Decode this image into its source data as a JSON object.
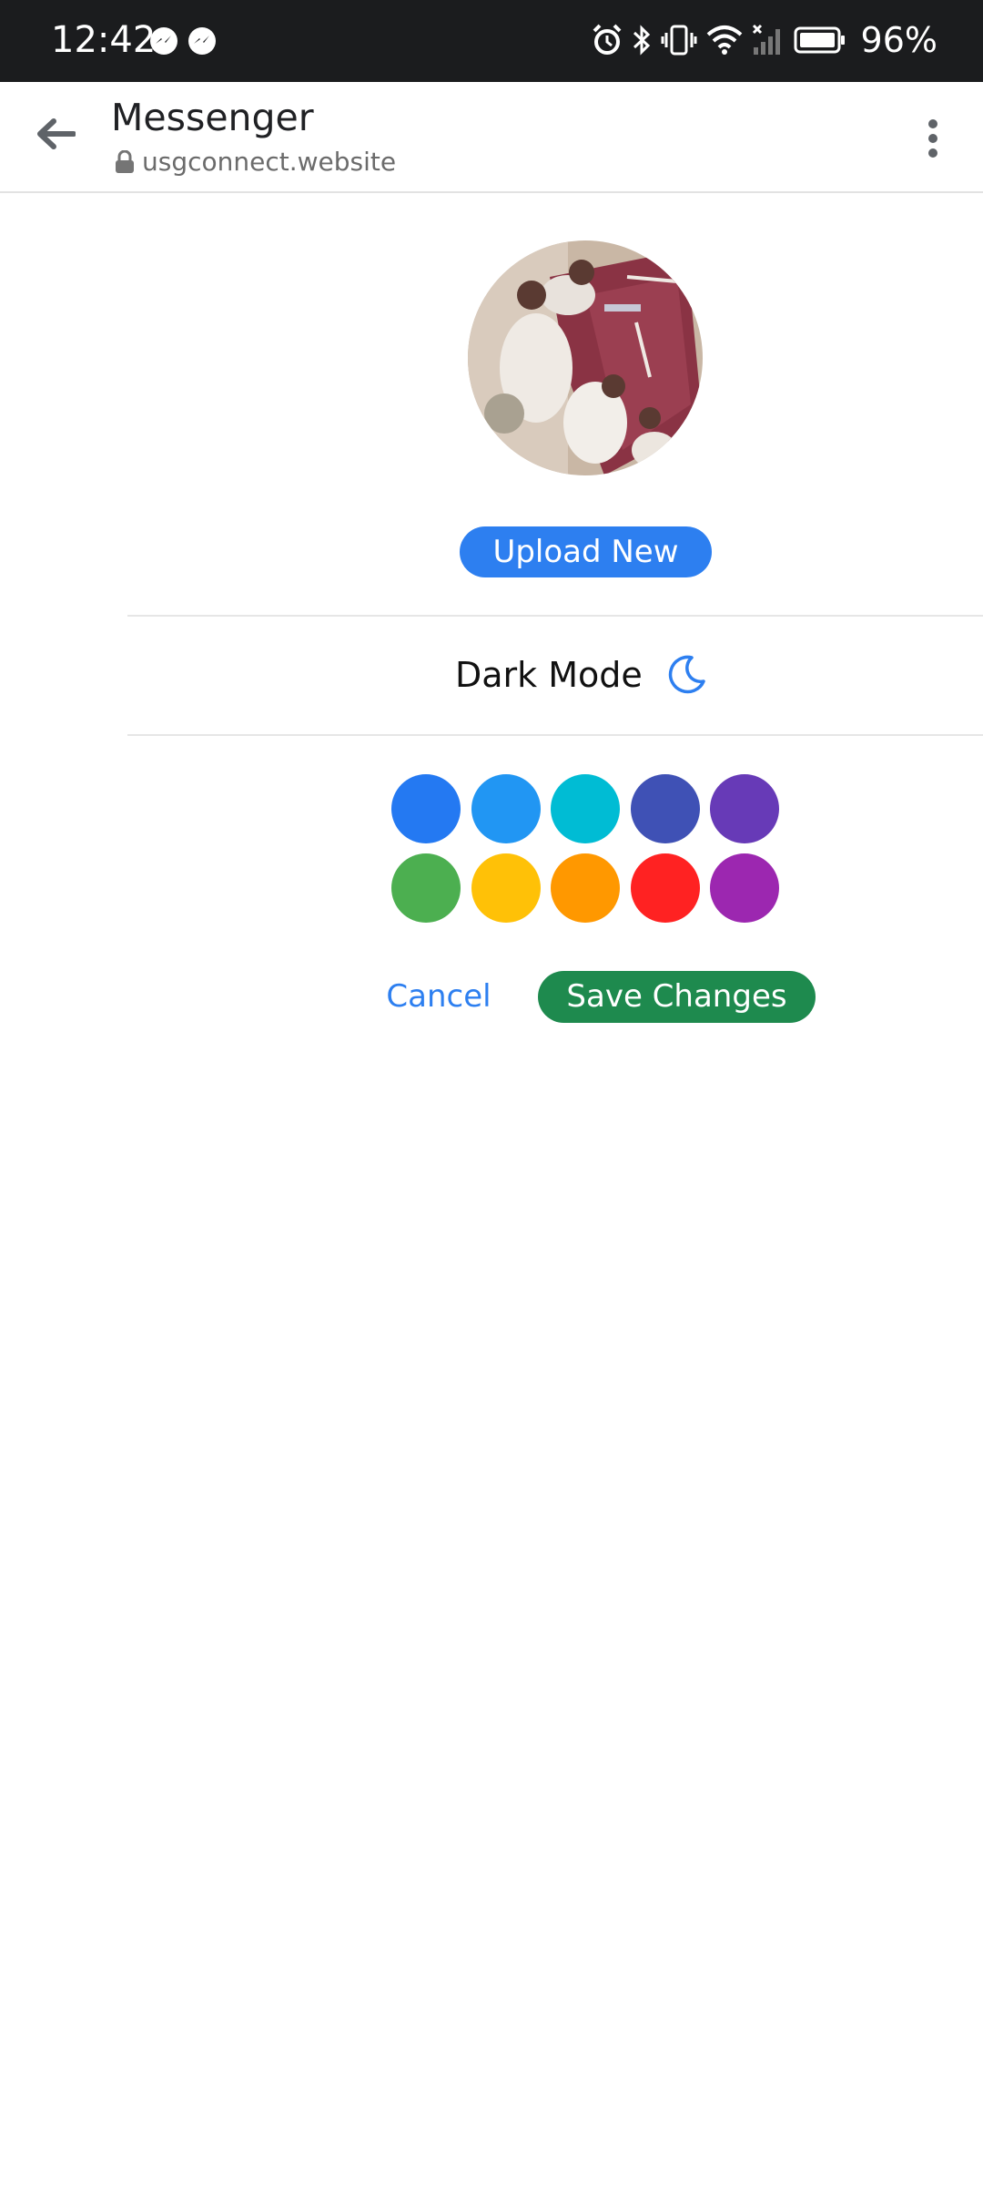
{
  "status_bar": {
    "time": "12:42",
    "notification_icons": [
      "messenger-icon",
      "messenger-icon"
    ],
    "system_icons": [
      "alarm-icon",
      "bluetooth-icon",
      "vibrate-icon",
      "wifi-icon",
      "signal-icon",
      "battery-icon"
    ],
    "battery_percent": "96%"
  },
  "app_bar": {
    "title": "Messenger",
    "url": "usgconnect.website",
    "back_icon": "arrow-back-icon",
    "menu_icon": "more-vert-icon"
  },
  "profile": {
    "avatar": "profile-photo",
    "upload_label": "Upload New"
  },
  "dark_mode": {
    "label": "Dark Mode",
    "icon": "moon-icon"
  },
  "theme_colors": [
    "#2479f2",
    "#2196f3",
    "#00bcd4",
    "#3f51b5",
    "#673ab7",
    "#4caf50",
    "#ffc107",
    "#ff9800",
    "#ff2222",
    "#9c27b0"
  ],
  "actions": {
    "cancel_label": "Cancel",
    "save_label": "Save Changes"
  },
  "colors": {
    "accent": "#2d7ff0",
    "save": "#1e8a4e"
  }
}
